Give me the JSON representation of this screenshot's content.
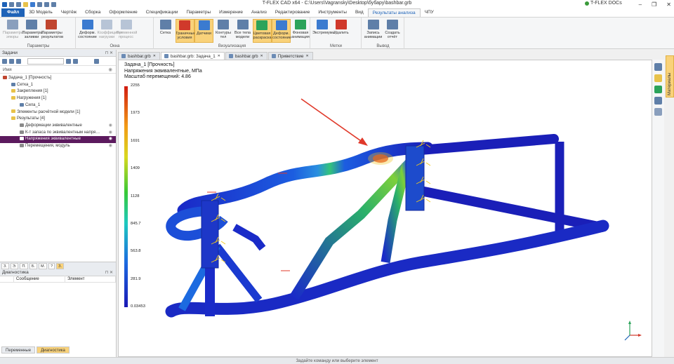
{
  "window": {
    "title": "T-FLEX CAD x64 - C:\\Users\\Vagransky\\Desktop\\бубару\\bashbar.grb",
    "docs_brand": "T-FLEX DOCs",
    "controls": [
      "–",
      "❐",
      "✕"
    ]
  },
  "ribbon_tabs": [
    {
      "label": "Файл",
      "kind": "file"
    },
    {
      "label": "3D Модель"
    },
    {
      "label": "Чертёж"
    },
    {
      "label": "Сборка"
    },
    {
      "label": "Оформление"
    },
    {
      "label": "Спецификации"
    },
    {
      "label": "Параметры"
    },
    {
      "label": "Измерение"
    },
    {
      "label": "Анализ"
    },
    {
      "label": "Редактирование"
    },
    {
      "label": "Инструменты"
    },
    {
      "label": "Вид"
    },
    {
      "label": "Результаты анализа",
      "kind": "active"
    },
    {
      "label": "ЧПУ"
    }
  ],
  "ribbon": {
    "groups": [
      {
        "label": "Параметры",
        "buttons": [
          {
            "label": "Параметры эпюры",
            "disabled": true,
            "color": "#8a9fbd"
          },
          {
            "label": "Параметры заливки",
            "color": "#5f7fa8"
          },
          {
            "label": "Параметры результатов",
            "color": "#c0452f"
          }
        ]
      },
      {
        "label": "Окна",
        "buttons": [
          {
            "label": "Деформ. состояние",
            "color": "#3b7bd0"
          },
          {
            "label": "Коэффициент нагрузки",
            "disabled": true,
            "color": "#b7c4d6"
          },
          {
            "label": "Временной процесс",
            "disabled": true,
            "color": "#b7c4d6"
          }
        ]
      },
      {
        "label": "Визуализация",
        "buttons": [
          {
            "label": "Сетка",
            "color": "#5f7fa8"
          },
          {
            "label": "Граничные условия",
            "on": true,
            "color": "#d0392b"
          },
          {
            "label": "Датчики",
            "on": true,
            "color": "#3b7bd0"
          },
          {
            "label": "Контуры тел",
            "color": "#5f7fa8"
          },
          {
            "label": "Все тела модели",
            "color": "#5f7fa8"
          },
          {
            "label": "Цветовая раскраска",
            "on": true,
            "color": "#2ca35a"
          },
          {
            "label": "Деформ. состояние",
            "on": true,
            "color": "#3b7bd0"
          },
          {
            "label": "Фоновая анимация",
            "color": "#2ca35a"
          }
        ]
      },
      {
        "label": "Метки",
        "buttons": [
          {
            "label": "Экстремумы",
            "color": "#3b7bd0"
          },
          {
            "label": "Удалить",
            "color": "#d0392b"
          }
        ]
      },
      {
        "label": "Вывод",
        "buttons": [
          {
            "label": "Запись анимации",
            "color": "#5f7fa8"
          },
          {
            "label": "Создать отчёт",
            "color": "#5f7fa8"
          }
        ]
      }
    ]
  },
  "left_panel": {
    "title": "Задачи",
    "column_name": "Имя",
    "tree": [
      {
        "label": "Задача_1 [Прочность]",
        "level": 0,
        "color": "#c0452f"
      },
      {
        "label": "Сетка_1",
        "level": 1,
        "color": "#5f7fa8"
      },
      {
        "label": "Закрепления [1]",
        "level": 1,
        "color": "#e8c24a"
      },
      {
        "label": "Нагружения [1]",
        "level": 1,
        "color": "#e8c24a"
      },
      {
        "label": "Сила_1",
        "level": 2,
        "color": "#5f7fa8"
      },
      {
        "label": "Элементы расчётной модели [1]",
        "level": 1,
        "color": "#e8c24a"
      },
      {
        "label": "Результаты [4]",
        "level": 1,
        "color": "#e8c24a"
      },
      {
        "label": "Деформации эквивалентные",
        "level": 2,
        "color": "#8a8a8a",
        "eye": true
      },
      {
        "label": "К-т запаса по эквивалентным напря…",
        "level": 2,
        "color": "#8a8a8a",
        "eye": true
      },
      {
        "label": "Напряжения эквивалентные",
        "level": 2,
        "color": "#ffffff",
        "selected": true,
        "eye": true
      },
      {
        "label": "Перемещения, модуль",
        "level": 2,
        "color": "#8a8a8a",
        "eye": true
      }
    ],
    "small_tabs": [
      "З.",
      "Э.",
      "П.",
      "Б.",
      "М.",
      "?",
      "З."
    ],
    "diagnostics_title": "Диагностика",
    "diag_columns": [
      "Сообщение",
      "Элемент"
    ],
    "bottom_tabs": [
      "Переменные",
      "Диагностика"
    ]
  },
  "doc_tabs": [
    {
      "label": "bashbar.grb"
    },
    {
      "label": "bashbar.grb: Задача_1",
      "active": true
    },
    {
      "label": "bashbar.grb"
    },
    {
      "label": "Приветствие"
    }
  ],
  "viewport": {
    "info": [
      "Задача_1 [Прочность]",
      "Напряжения эквивалентные, МПа",
      "Масштаб перемещений: 4.86"
    ],
    "legend_ticks": [
      "2255",
      "1973",
      "1691",
      "1409",
      "1128",
      "845.7",
      "563.8",
      "281.9",
      "0.03453"
    ],
    "right_panel_label": "Материалы"
  },
  "status": "Задайте команду или выберите элемент"
}
